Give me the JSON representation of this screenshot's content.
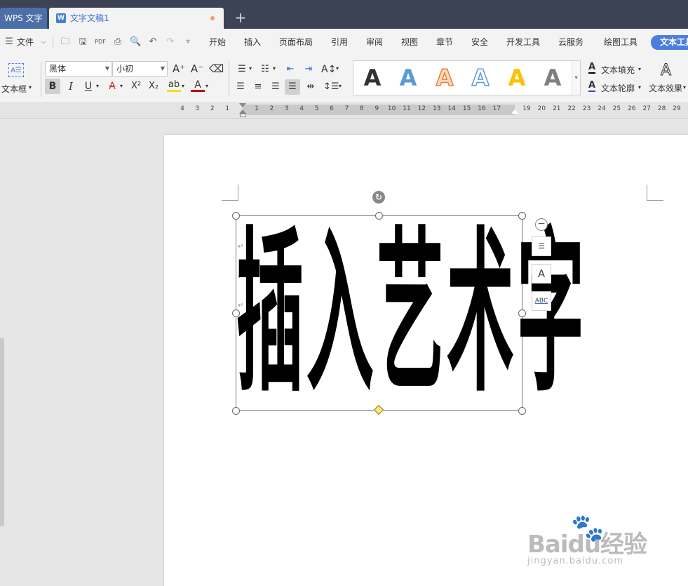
{
  "window": {
    "app_tab": "WPS 文字",
    "doc_tab": "文字文稿1",
    "doc_icon": "W",
    "add_tab": "+"
  },
  "menu": {
    "hamburger_label": "文件",
    "items": [
      "开始",
      "插入",
      "页面布局",
      "引用",
      "审阅",
      "视图",
      "章节",
      "安全",
      "开发工具",
      "云服务",
      "绘图工具"
    ],
    "active_tab": "文本工具"
  },
  "ribbon": {
    "textbox_label": "文本框",
    "font_name": "黑体",
    "font_size": "小初",
    "bold": "B",
    "italic": "I",
    "underline": "U",
    "strikethrough": "A",
    "superscript": "X²",
    "subscript": "X₂",
    "highlight": "ab",
    "font_color": "A",
    "grow_font": "A⁺",
    "shrink_font": "A⁻",
    "style_letter": "A",
    "text_fill_label": "文本填充",
    "text_outline_label": "文本轮廓",
    "text_effect_label": "文本效果",
    "style_colors": [
      "#000000",
      "#5b9bd5",
      "#ed7d31",
      "#ffffff",
      "#ffc000",
      "#7f7f7f"
    ]
  },
  "ruler": {
    "left_numbers": [
      "4",
      "3",
      "2",
      "1"
    ],
    "mid_numbers": [
      "1",
      "2",
      "3",
      "4",
      "5",
      "6",
      "7",
      "8",
      "9",
      "10",
      "11",
      "12",
      "13",
      "14",
      "15",
      "16",
      "17"
    ],
    "right_numbers": [
      "19",
      "20",
      "21",
      "22",
      "23",
      "24",
      "25",
      "26",
      "27",
      "28",
      "29"
    ]
  },
  "document": {
    "art_text": "插入艺术字",
    "paragraph_mark": "↵"
  },
  "side_tools": {
    "layout_icon": "layout-icon",
    "style_icon": "A",
    "spell_icon": "ABC"
  },
  "watermark": {
    "brand": "Baidu经验",
    "url": "jingyan.baidu.com"
  }
}
